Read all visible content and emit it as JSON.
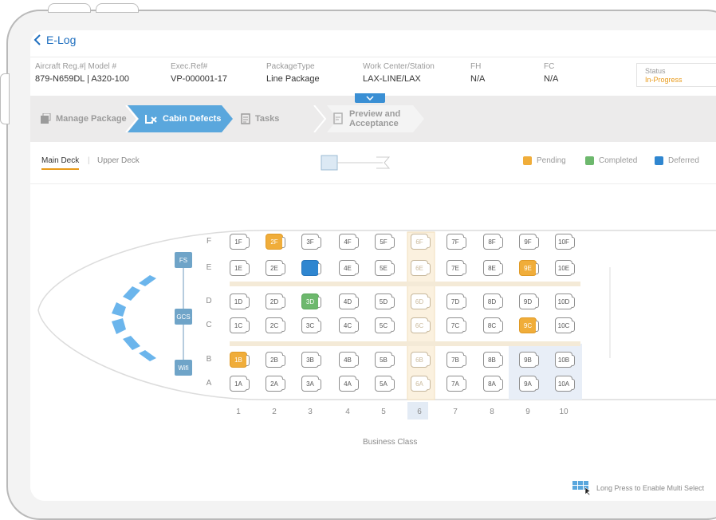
{
  "header": {
    "back_label": "E-Log"
  },
  "info": [
    {
      "label": "Aircraft Reg.#| Model #",
      "value": "879-N659DL |  A320-100"
    },
    {
      "label": "Exec.Ref#",
      "value": "VP-000001-17"
    },
    {
      "label": "PackageType",
      "value": "Line Package"
    },
    {
      "label": "Work Center/Station",
      "value": "LAX-LINE/LAX"
    },
    {
      "label": "FH",
      "value": "N/A"
    },
    {
      "label": "FC",
      "value": "N/A"
    }
  ],
  "status": {
    "label": "Status",
    "value": "In-Progress"
  },
  "steps": [
    "Manage Package",
    "Cabin Defects",
    "Tasks",
    "Preview and",
    "Acceptance"
  ],
  "tabs": [
    "Main Deck",
    "Upper Deck"
  ],
  "legend": [
    {
      "label": "Pending",
      "color": "#f0ad3a"
    },
    {
      "label": "Completed",
      "color": "#6db86d"
    },
    {
      "label": "Deferred",
      "color": "#2f86d0"
    }
  ],
  "galleys": [
    "FS",
    "GCS",
    "Wifi"
  ],
  "rows": [
    "F",
    "E",
    "D",
    "C",
    "B",
    "A"
  ],
  "columns": [
    "1",
    "2",
    "3",
    "4",
    "5",
    "6",
    "7",
    "8",
    "9",
    "10"
  ],
  "seats": {
    "F": [
      "1F",
      "2F",
      "3F",
      "4F",
      "5F",
      "6F",
      "7F",
      "8F",
      "9F",
      "10F"
    ],
    "E": [
      "1E",
      "2E",
      "",
      "4E",
      "5E",
      "6E",
      "7E",
      "8E",
      "9E",
      "10E"
    ],
    "D": [
      "1D",
      "2D",
      "3D",
      "4D",
      "5D",
      "6D",
      "7D",
      "8D",
      "9D",
      "10D"
    ],
    "C": [
      "1C",
      "2C",
      "3C",
      "4C",
      "5C",
      "6C",
      "7C",
      "8C",
      "9C",
      "10C"
    ],
    "B": [
      "1B",
      "2B",
      "3B",
      "4B",
      "5B",
      "6B",
      "7B",
      "8B",
      "9B",
      "10B"
    ],
    "A": [
      "1A",
      "2A",
      "3A",
      "4A",
      "5A",
      "6A",
      "7A",
      "8A",
      "9A",
      "10A"
    ]
  },
  "seat_status": {
    "2F": "pending",
    "3E": "deferred",
    "9E": "pending",
    "3D": "completed",
    "9C": "pending",
    "1B": "pending"
  },
  "cabin_label": "Business Class",
  "multiselect_hint": "Long Press to Enable Multi Select"
}
